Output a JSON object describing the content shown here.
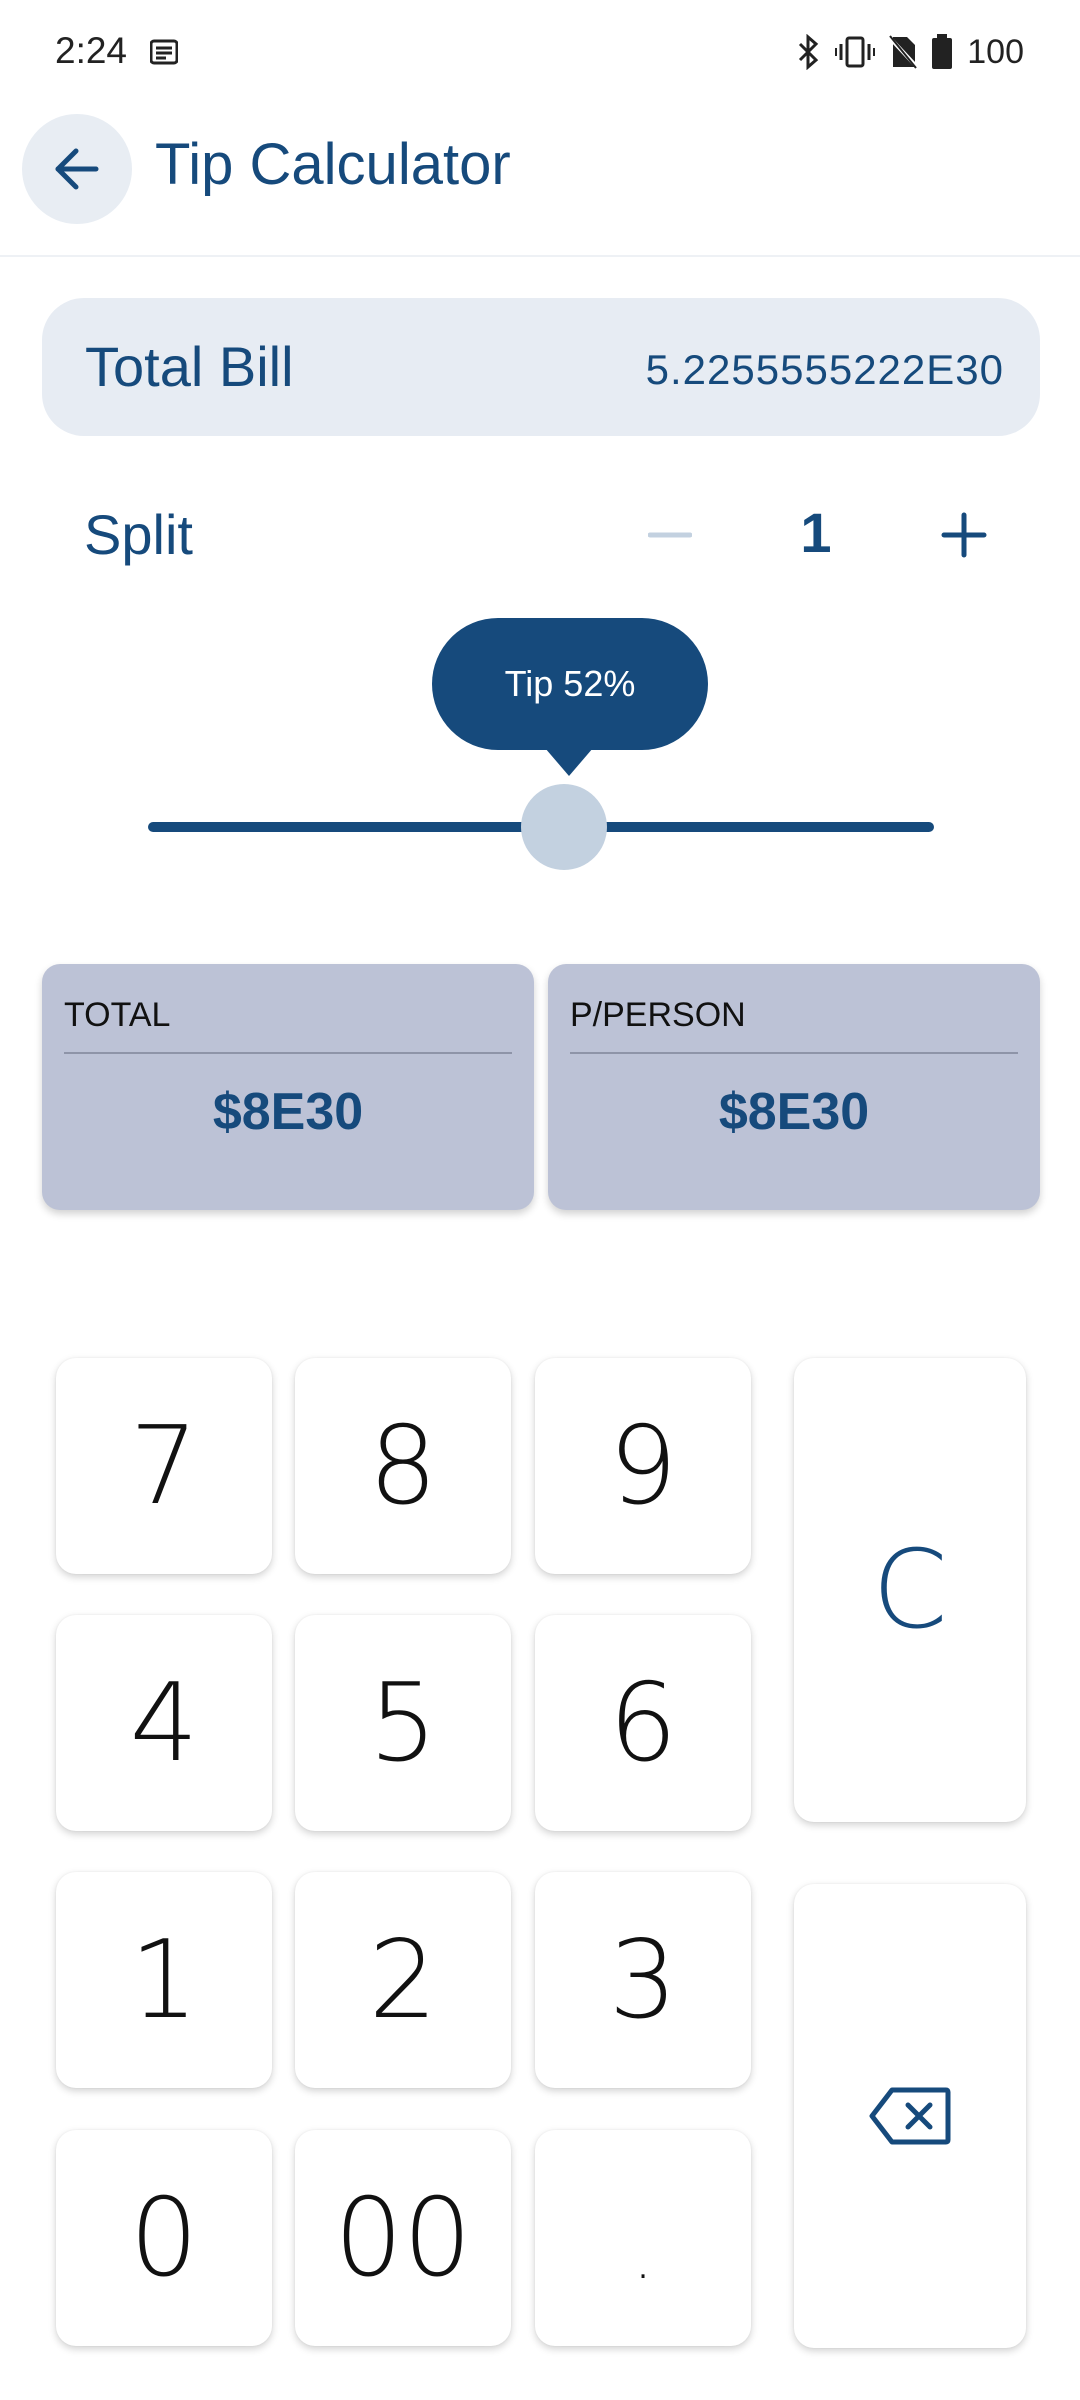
{
  "status_bar": {
    "time": "2:24",
    "battery": "100"
  },
  "app_bar": {
    "title": "Tip Calculator"
  },
  "bill": {
    "label": "Total Bill",
    "value": "5.2255555222E30"
  },
  "split": {
    "label": "Split",
    "value": "1"
  },
  "tip": {
    "label": "Tip 52%",
    "percent": 52
  },
  "results": {
    "total_label": "TOTAL",
    "total_value": "$8E30",
    "per_person_label": "P/PERSON",
    "per_person_value": "$8E30"
  },
  "keypad": {
    "k7": "7",
    "k8": "8",
    "k9": "9",
    "k4": "4",
    "k5": "5",
    "k6": "6",
    "k1": "1",
    "k2": "2",
    "k3": "3",
    "k0": "0",
    "k00": "00",
    "kdot": ".",
    "clear": "C"
  },
  "colors": {
    "primary": "#164a7c",
    "card": "#bcc2d6",
    "bill_bg": "#e7ecf3"
  }
}
